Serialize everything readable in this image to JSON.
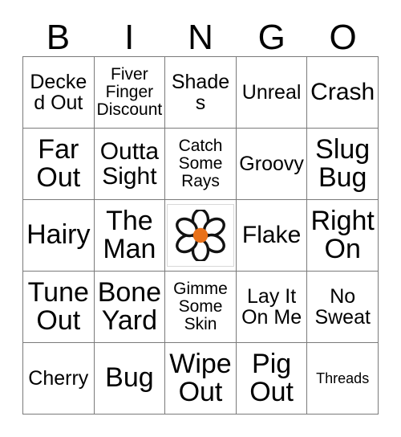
{
  "card": {
    "header": {
      "letters": [
        "B",
        "I",
        "N",
        "G",
        "O"
      ]
    },
    "grid": {
      "rows": [
        [
          {
            "text": "Decked Out",
            "size": "fs-md"
          },
          {
            "text": "Fiver Finger Discount",
            "size": "fs-sm"
          },
          {
            "text": "Shades",
            "size": "fs-md"
          },
          {
            "text": "Unreal",
            "size": "fs-md"
          },
          {
            "text": "Crash",
            "size": "fs-lg"
          }
        ],
        [
          {
            "text": "Far Out",
            "size": "fs-xl"
          },
          {
            "text": "Outta Sight",
            "size": "fs-lg"
          },
          {
            "text": "Catch Some Rays",
            "size": "fs-sm"
          },
          {
            "text": "Groovy",
            "size": "fs-md"
          },
          {
            "text": "Slug Bug",
            "size": "fs-xl"
          }
        ],
        [
          {
            "text": "Hairy",
            "size": "fs-xl"
          },
          {
            "text": "The Man",
            "size": "fs-xl"
          },
          {
            "free": true,
            "icon": "daisy-flower-icon"
          },
          {
            "text": "Flake",
            "size": "fs-lg"
          },
          {
            "text": "Right On",
            "size": "fs-xl"
          }
        ],
        [
          {
            "text": "Tune Out",
            "size": "fs-xl"
          },
          {
            "text": "Bone Yard",
            "size": "fs-xl"
          },
          {
            "text": "Gimme Some Skin",
            "size": "fs-sm"
          },
          {
            "text": "Lay It On Me",
            "size": "fs-md"
          },
          {
            "text": "No Sweat",
            "size": "fs-md"
          }
        ],
        [
          {
            "text": "Cherry",
            "size": "fs-md"
          },
          {
            "text": "Bug",
            "size": "fs-xl"
          },
          {
            "text": "Wipe Out",
            "size": "fs-xl"
          },
          {
            "text": "Pig Out",
            "size": "fs-xl"
          },
          {
            "text": "Threads",
            "size": "fs-xs"
          }
        ]
      ]
    },
    "colors": {
      "grid_line": "#7a7a7a",
      "text": "#000000",
      "background": "#ffffff",
      "flower_center": "#e8711a",
      "flower_outline": "#121212",
      "flower_petal": "#ffffff",
      "free_frame": "#d8d8d8"
    }
  }
}
